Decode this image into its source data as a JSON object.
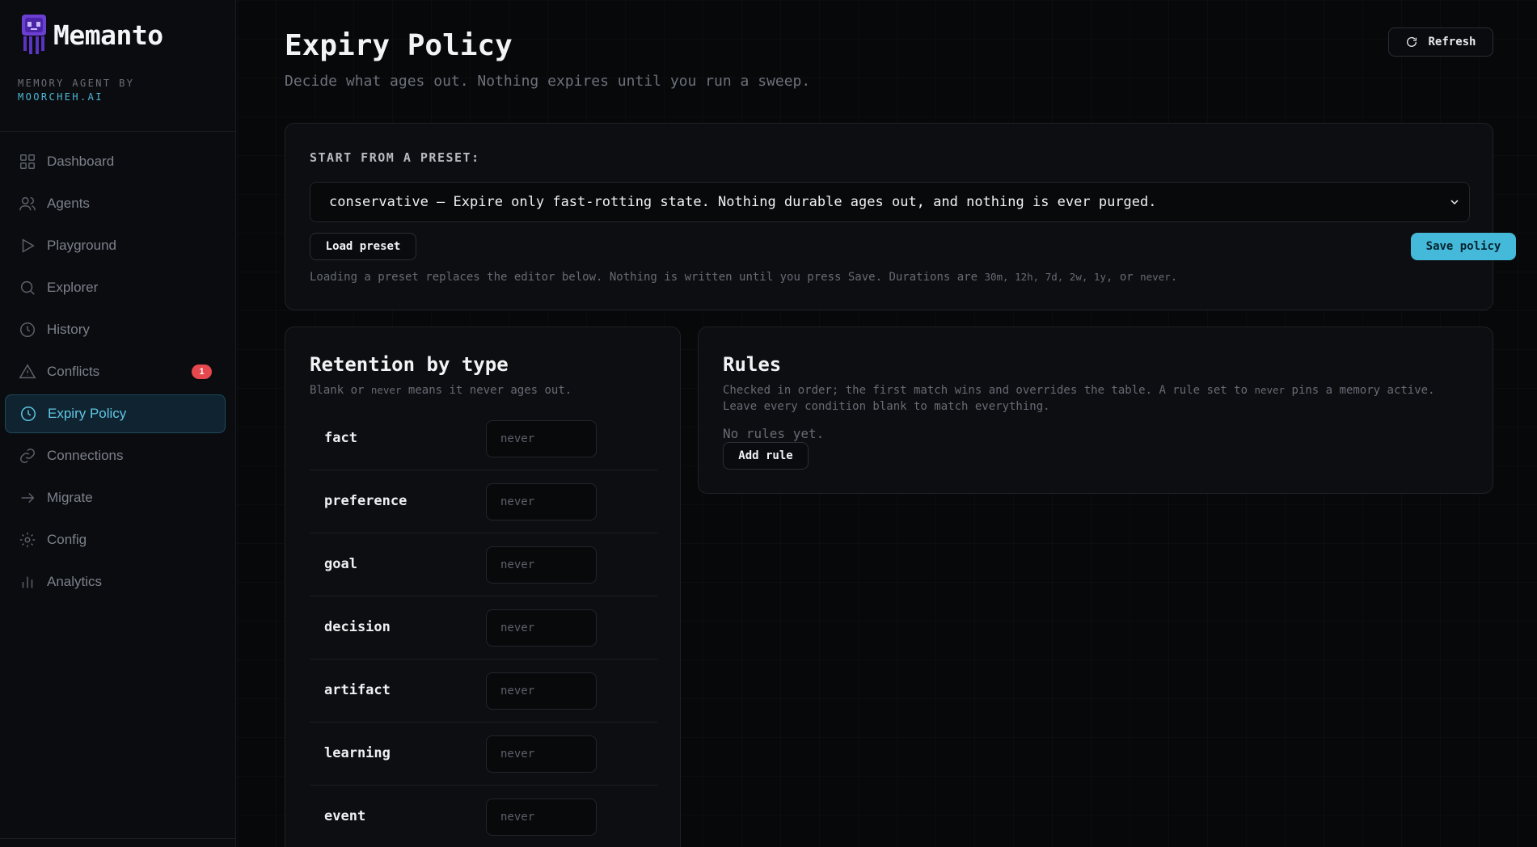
{
  "brand": {
    "name": "Memanto",
    "subtitle_line1": "MEMORY AGENT BY",
    "subtitle_line2": "MOORCHEH.AI",
    "accent_color": "#4bb8d6"
  },
  "sidebar": {
    "items": [
      {
        "label": "Dashboard",
        "icon": "grid-icon"
      },
      {
        "label": "Agents",
        "icon": "users-icon"
      },
      {
        "label": "Playground",
        "icon": "play-icon"
      },
      {
        "label": "Explorer",
        "icon": "search-icon"
      },
      {
        "label": "History",
        "icon": "clock-icon"
      },
      {
        "label": "Conflicts",
        "icon": "warning-icon",
        "badge": "1"
      },
      {
        "label": "Expiry Policy",
        "icon": "clock-icon",
        "active": true
      },
      {
        "label": "Connections",
        "icon": "link-icon"
      },
      {
        "label": "Migrate",
        "icon": "arrow-right-icon"
      },
      {
        "label": "Config",
        "icon": "gear-icon"
      },
      {
        "label": "Analytics",
        "icon": "bar-chart-icon"
      }
    ]
  },
  "header": {
    "title": "Expiry Policy",
    "subtitle": "Decide what ages out. Nothing expires until you run a sweep.",
    "refresh_label": "Refresh"
  },
  "preset": {
    "label": "START FROM A PRESET:",
    "selected": "conservative — Expire only fast-rotting state. Nothing durable ages out, and nothing is ever purged.",
    "load_label": "Load preset",
    "save_label": "Save policy",
    "note_prefix": "Loading a preset replaces the editor below. Nothing is written until you press Save. Durations are ",
    "note_durations": "30m, 12h, 7d, 2w, 1y",
    "note_or": ", or ",
    "note_never": "never",
    "note_end": "."
  },
  "retention": {
    "title": "Retention by type",
    "sub_blank": "Blank or ",
    "sub_never": "never",
    "sub_rest": " means it never ages out.",
    "placeholder": "never",
    "rows": [
      {
        "type": "fact",
        "value": ""
      },
      {
        "type": "preference",
        "value": ""
      },
      {
        "type": "goal",
        "value": ""
      },
      {
        "type": "decision",
        "value": ""
      },
      {
        "type": "artifact",
        "value": ""
      },
      {
        "type": "learning",
        "value": ""
      },
      {
        "type": "event",
        "value": ""
      }
    ]
  },
  "rules": {
    "title": "Rules",
    "sub_part1": "Checked in order; the first match wins and overrides the table. A rule set to ",
    "sub_never": "never",
    "sub_part2": " pins a memory active. Leave every condition blank to match everything.",
    "empty_text": "No rules yet.",
    "add_label": "Add rule"
  }
}
